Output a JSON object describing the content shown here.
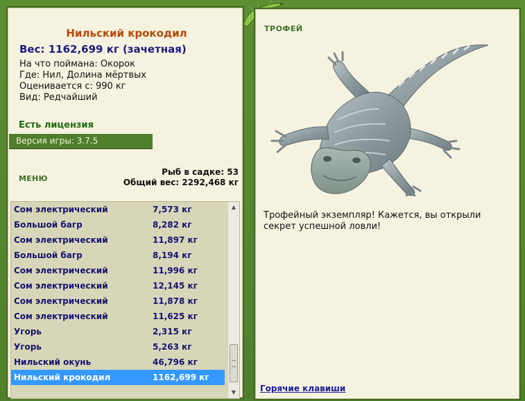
{
  "trophy": {
    "name": "Нильский крокодил",
    "weight": "Вес: 1162,699 кг (зачетная)",
    "bait": "На что поймана: Окорок",
    "location": "Где: Нил, Долина мёртвых",
    "valued_from": "Оценивается с: 990 кг",
    "rarity": "Вид: Редчайший"
  },
  "license": "Есть лицензия",
  "version": "Версия игры: 3.7.5",
  "menu_label": "МЕНЮ",
  "keepnet": {
    "fish_count": "Рыб в садке: 53",
    "total_weight": "Общий вес: 2292,468 кг"
  },
  "catches": [
    {
      "name": "Сом электрический",
      "weight": "7,573 кг"
    },
    {
      "name": "Большой багр",
      "weight": "8,282 кг"
    },
    {
      "name": "Сом электрический",
      "weight": "11,897 кг"
    },
    {
      "name": "Большой багр",
      "weight": "8,194 кг"
    },
    {
      "name": "Сом электрический",
      "weight": "11,996 кг"
    },
    {
      "name": "Сом электрический",
      "weight": "12,145 кг"
    },
    {
      "name": "Сом электрический",
      "weight": "11,878 кг"
    },
    {
      "name": "Сом электрический",
      "weight": "11,625 кг"
    },
    {
      "name": "Угорь",
      "weight": "2,315 кг"
    },
    {
      "name": "Угорь",
      "weight": "5,263 кг"
    },
    {
      "name": "Нильский окунь",
      "weight": "46,796 кг"
    },
    {
      "name": "Нильский крокодил",
      "weight": "1162,699 кг",
      "selected": true
    }
  ],
  "trophy_panel": {
    "title": "ТРОФЕЙ",
    "message": "Трофейный экземпляр! Кажется, вы открыли секрет успешной ловли!"
  },
  "hotkeys_label": "Горячие клавиши",
  "colors": {
    "frame": "#4f7f2b",
    "panel": "#f6f2e0",
    "list_bg": "#d8d6b8",
    "selection": "#3399ff",
    "fish_name": "#b34a0a",
    "list_text": "#14146e"
  }
}
